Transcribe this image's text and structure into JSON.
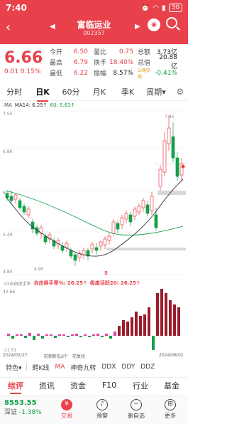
{
  "status": {
    "time": "7:40",
    "battery": "30"
  },
  "header": {
    "title": "富临运业",
    "code": "002357",
    "back": "‹",
    "prev": "◀",
    "next": "▶"
  },
  "quote": {
    "price": "6.66",
    "change": "0.01  0.15%",
    "row1": [
      "今开",
      "6.50",
      "量比",
      "0.75",
      "总额",
      "3.73亿"
    ],
    "row2": [
      "最高",
      "6.79",
      "换手",
      "18.40%",
      "总值",
      "20.88亿"
    ],
    "row3": [
      "最低",
      "6.22",
      "振幅",
      "8.57%",
      "公路铁路",
      "-0.41%"
    ]
  },
  "period_tabs": [
    "分时",
    "日K",
    "60分",
    "月K",
    "季K",
    "周期▾"
  ],
  "active_period": "日K",
  "ma_legend": {
    "label": "MA",
    "ma14": "MA14: 6.25↑",
    "ma60": "60: 5.63↑"
  },
  "price_chart": {
    "y_labels": [
      "7.55",
      "6.86",
      "6.17",
      "5.49",
      "4.80"
    ],
    "high_label": "7.45",
    "low_label": "4.90",
    "marker": "S"
  },
  "indicator": {
    "name": "02自由换手率",
    "val1": "自由换手率%: 26.25↑",
    "val2": "极度活跃20: 26.25↑",
    "y_top": "42.66",
    "y_bottom": "-11.51"
  },
  "dates": {
    "start": "2024/05/27",
    "mid1": "前期新低d个",
    "mid2": "前复权",
    "end": "2024/08/02"
  },
  "indicator_tabs": [
    "特色▾",
    "鳄K线",
    "MA",
    "神奇九转",
    "DDX",
    "DDY",
    "DDZ"
  ],
  "bottom_tabs": [
    "综评",
    "资讯",
    "资金",
    "F10",
    "行业",
    "基金",
    "扌"
  ],
  "bottom_bar": {
    "index_value": "8553.55",
    "index_name": "深证",
    "index_change": "-1.38%",
    "items": [
      "交易",
      "预警",
      "删自选",
      "更多"
    ]
  },
  "chart_data": {
    "type": "candlestick",
    "y_range": [
      4.8,
      7.55
    ],
    "y_ticks": [
      7.55,
      6.86,
      6.17,
      5.49,
      4.8
    ],
    "annotations": {
      "high": 7.45,
      "low": 4.9
    },
    "last_close": 6.66,
    "ma14": 6.25,
    "ma60": 5.63,
    "turnover_range": [
      -11.51,
      42.66
    ],
    "last_turnover": 26.25
  }
}
